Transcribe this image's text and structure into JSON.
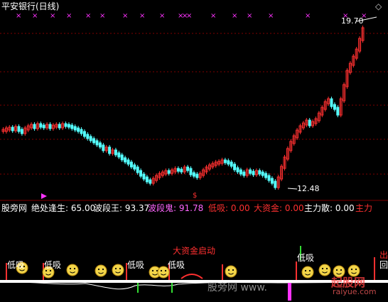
{
  "header": {
    "title": "平安银行(日线)",
    "diamond": "◇"
  },
  "price_labels": {
    "high": "19.70",
    "low": "12.48"
  },
  "indicator": {
    "name": "股旁网",
    "items": [
      {
        "label": "绝处逢生:",
        "value": "65.00",
        "color": "#ffffff"
      },
      {
        "label": "波段王:",
        "value": "93.37",
        "color": "#ffffff"
      },
      {
        "label": "波段鬼:",
        "value": "91.78",
        "color": "#ff66ff"
      },
      {
        "label": "低吸:",
        "value": "0.00",
        "color": "#ff3030"
      },
      {
        "label": "大资金:",
        "value": "0.00",
        "color": "#ff3030"
      },
      {
        "label": "主力散:",
        "value": "0.00",
        "color": "#ffffff"
      },
      {
        "label": "主力",
        "value": "",
        "color": "#ff3030"
      }
    ]
  },
  "signals": {
    "big_capital_start": "大资金启动",
    "low_buy_labels": [
      "低吸",
      "低吸",
      "低吸",
      "低吸",
      "低吸"
    ],
    "out": "出",
    "back": "回"
  },
  "watermarks": {
    "left": "股旁网 www.",
    "right": "起股网",
    "sub": "raiyue.com"
  },
  "colors": {
    "up": "#ff3030",
    "down": "#54ffff",
    "grid": "#800000",
    "cross": "#ff33ff"
  }
}
